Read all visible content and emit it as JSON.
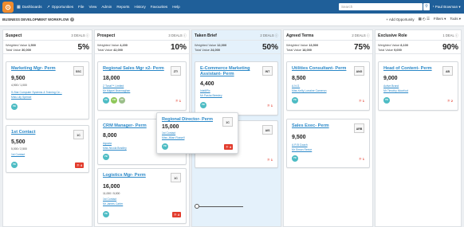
{
  "app": {
    "logo": "⊙",
    "nav": [
      {
        "label": "Dashboards",
        "icon": "▦"
      },
      {
        "label": "Opportunities",
        "icon": "↗"
      },
      {
        "label": "File",
        "icon": ""
      },
      {
        "label": "View",
        "icon": ""
      },
      {
        "label": "Admin",
        "icon": ""
      },
      {
        "label": "Reports",
        "icon": ""
      },
      {
        "label": "History",
        "icon": ""
      },
      {
        "label": "Favourites",
        "icon": ""
      },
      {
        "label": "Help",
        "icon": ""
      }
    ],
    "search_placeholder": "Search",
    "user": "¹ Paul Bowman ▾"
  },
  "workflow": {
    "title": "BUSINESS DEVELOPMENT WORKFLOW",
    "info": "i",
    "add_label": "+ Add Opportunity",
    "filters_label": "Filters ▾",
    "tools_label": "Tools ▾",
    "view_icons": "▦ ◴ ☰"
  },
  "columns": [
    {
      "name": "Suspect",
      "deals": "3 DEALS ⓘ",
      "weighted": "1,500",
      "total": "30,000",
      "pct": "5%"
    },
    {
      "name": "Prospect",
      "deals": "3 DEALS ⓘ",
      "weighted": "4,200",
      "total": "42,000",
      "pct": "10%"
    },
    {
      "name": "Taken Brief",
      "deals": "2 DEALS ⓘ",
      "weighted": "12,000",
      "total": "24,000",
      "pct": "50%"
    },
    {
      "name": "Agreed Terms",
      "deals": "2 DEALS ⓘ",
      "weighted": "13,500",
      "total": "18,000",
      "pct": "75%"
    },
    {
      "name": "Exclusive Role",
      "deals": "1 DEAL ⓘ",
      "weighted": "8,100",
      "total": "9,000",
      "pct": "90%"
    }
  ],
  "labels": {
    "weighted": "Weighted Value",
    "total": "Total Value"
  },
  "cards": {
    "c1": {
      "title": "Marketing Mgr- Perm",
      "code": "SSC",
      "amount": "9,500",
      "sub": "4,900 / 1,000",
      "links": [
        "S-Star Computer Systems & Training Ce...",
        "Miss Lily Spence"
      ],
      "badges": [
        "PB"
      ],
      "flag": ""
    },
    "c2": {
      "title": "1st Contact",
      "code": "1C",
      "amount": "5,500",
      "sub": "5,000 / 2,500",
      "links": [
        "1st Contact"
      ],
      "badges": [
        "PB"
      ],
      "flag": "⚐ 4"
    },
    "c3": {
      "title": "Regional Sales Mgr x2- Perm",
      "code": "ZT!",
      "amount": "18,000",
      "sub": "",
      "links": [
        "Z Tonal™ Limited",
        "Mr Miguel Brannaghan"
      ],
      "badges": [
        "PB",
        "CW",
        "DP"
      ],
      "flag": "⚐ 1"
    },
    "c4": {
      "title": "CRM Manager- Perm",
      "code": "",
      "amount": "8,000",
      "sub": "",
      "links": [
        "Aquara",
        "Miss Nicola Bradley"
      ],
      "badges": [
        "PB"
      ],
      "flag": ""
    },
    "c5": {
      "title": "Logistics Mgr- Perm",
      "code": "1C",
      "amount": "16,000",
      "sub": "11,000 / 5,000",
      "links": [
        "1st Contact",
        "Mr James Carter"
      ],
      "badges": [
        "PB"
      ],
      "flag": "⚐ 4"
    },
    "c6": {
      "title": "E-Commerce Marketing Assistant- Perm",
      "code": "INT",
      "amount": "4,400",
      "sub": "",
      "links": [
        "IntelliPix",
        "Mr Pasha Beesley"
      ],
      "badges": [
        "PB"
      ],
      "flag": "⚐ 1"
    },
    "c7": {
      "title": "",
      "code": "AIS",
      "amount": "",
      "sub": "",
      "links": [],
      "badges": [],
      "flag": "⚐ 1"
    },
    "c8": {
      "title": "Utilities Consultant- Perm",
      "code": "ANG",
      "amount": "8,500",
      "sub": "",
      "links": [
        "A.N.G.",
        "Miss Kelly Lorraine Cameron"
      ],
      "badges": [
        "PB"
      ],
      "flag": "⚐ 1"
    },
    "c9": {
      "title": "Sales Exec- Perm",
      "code": "ARB",
      "amount": "9,500",
      "sub": "",
      "links": [
        "A.R.B Coach",
        "Mr Simon Reece"
      ],
      "badges": [
        "PB"
      ],
      "flag": "⚐ 1"
    },
    "c10": {
      "title": "Head of Content- Perm",
      "code": "AB",
      "amount": "9,000",
      "sub": "",
      "links": [
        "Active Brand",
        "Mr Timothy Moorfoot"
      ],
      "badges": [
        "PB"
      ],
      "flag": "⚐ 2"
    },
    "drag": {
      "title": "Regional Director- Perm",
      "code": "1C",
      "amount": "15,000",
      "sub": "",
      "links": [
        "1st Contact",
        "Miss Jillian Russell"
      ],
      "badges": [
        "PB"
      ],
      "flag": "⚐ 4"
    }
  }
}
